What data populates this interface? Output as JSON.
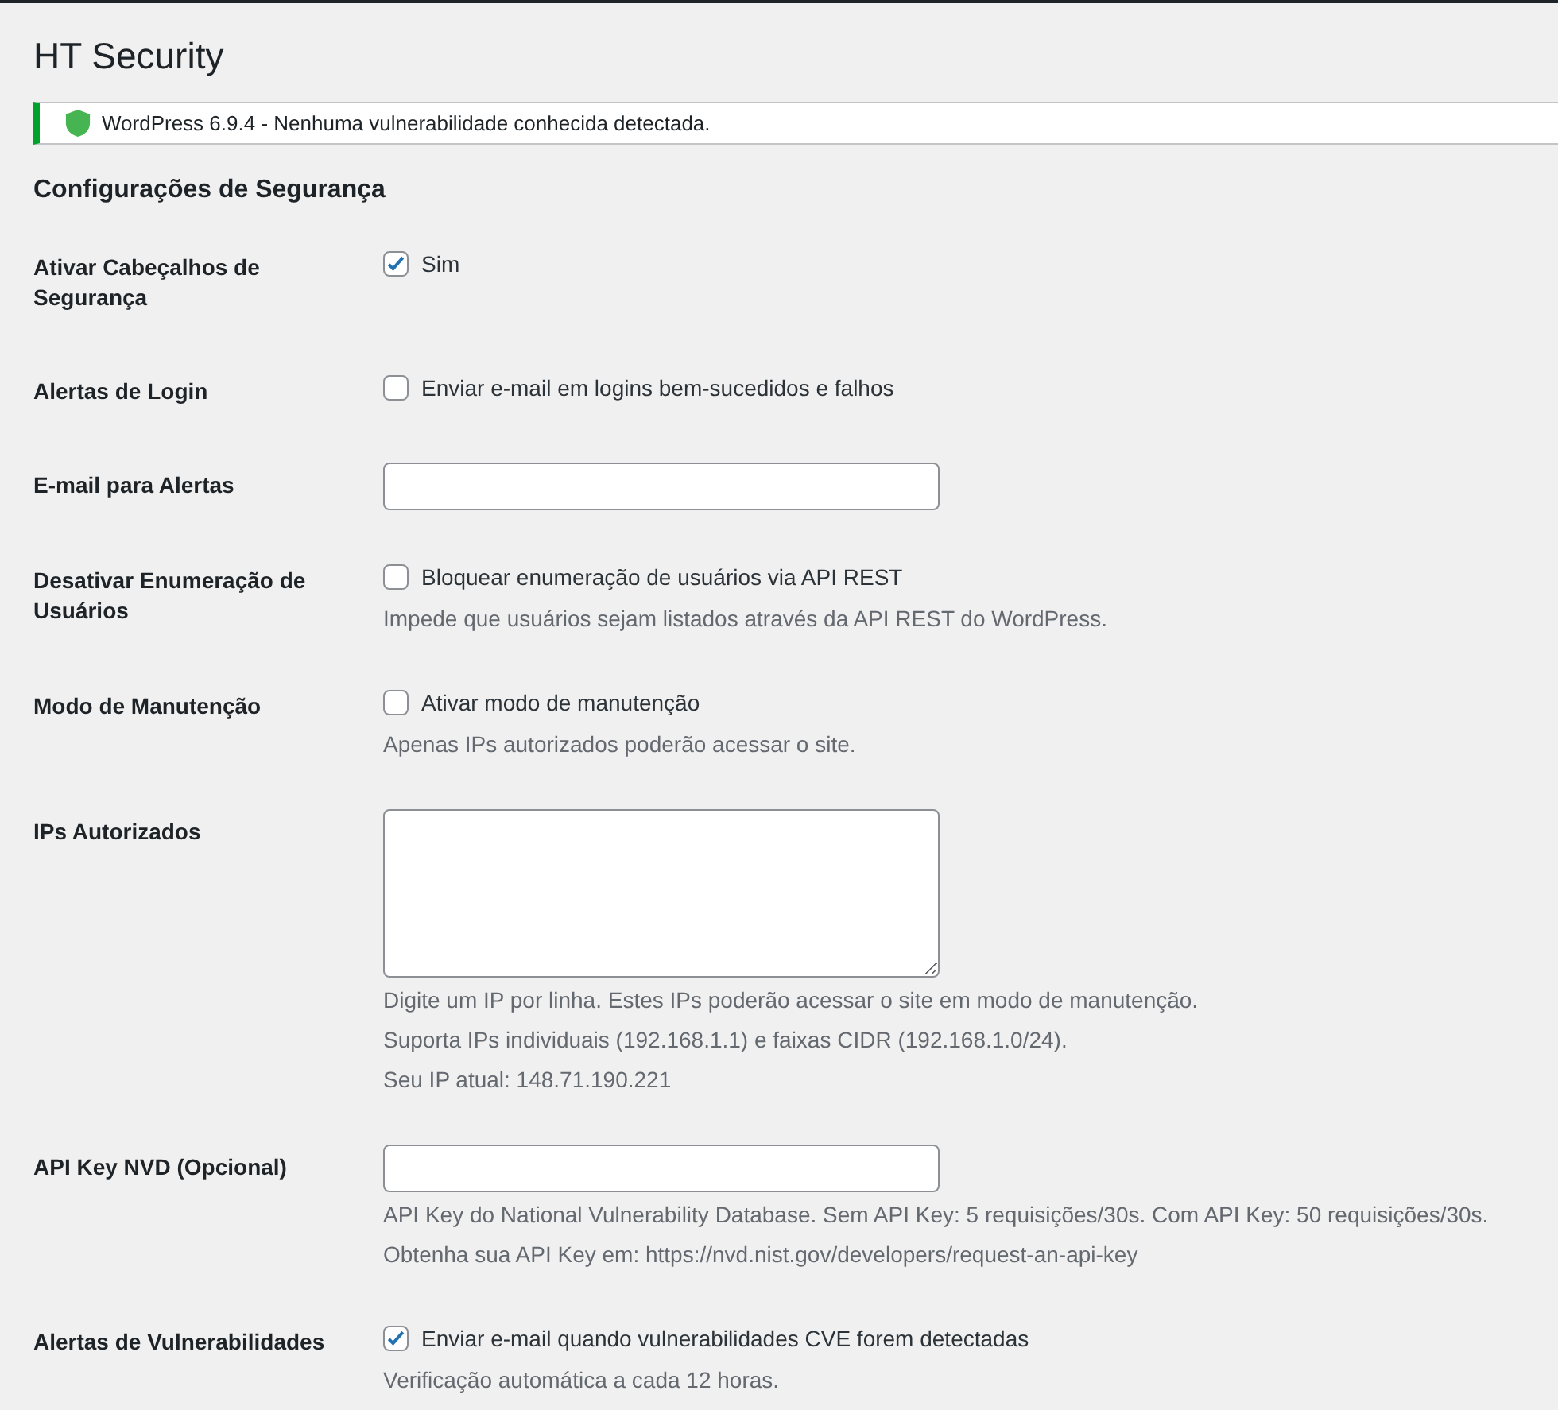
{
  "page_title": "HT Security",
  "notice": {
    "text": "WordPress 6.9.4 - Nenhuma vulnerabilidade conhecida detectada."
  },
  "section_title": "Configurações de Segurança",
  "fields": [
    {
      "label": "Ativar Cabeçalhos de Segurança",
      "kind": "checkbox",
      "checked": true,
      "option": "Sim"
    },
    {
      "label": "Alertas de Login",
      "kind": "checkbox",
      "checked": false,
      "option": "Enviar e-mail em logins bem-sucedidos e falhos"
    },
    {
      "label": "E-mail para Alertas",
      "kind": "text"
    },
    {
      "label": "Desativar Enumeração de Usuários",
      "kind": "checkbox",
      "checked": false,
      "option": "Bloquear enumeração de usuários via API REST",
      "descriptions": [
        "Impede que usuários sejam listados através da API REST do WordPress."
      ]
    },
    {
      "label": "Modo de Manutenção",
      "kind": "checkbox",
      "checked": false,
      "option": "Ativar modo de manutenção",
      "descriptions": [
        "Apenas IPs autorizados poderão acessar o site."
      ]
    },
    {
      "label": "IPs Autorizados",
      "kind": "textarea",
      "descriptions": [
        "Digite um IP por linha. Estes IPs poderão acessar o site em modo de manutenção.",
        "Suporta IPs individuais (192.168.1.1) e faixas CIDR (192.168.1.0/24).",
        "Seu IP atual: 148.71.190.221"
      ]
    },
    {
      "label": "API Key NVD (Opcional)",
      "kind": "text",
      "descriptions": [
        "API Key do National Vulnerability Database. Sem API Key: 5 requisições/30s. Com API Key: 50 requisições/30s.",
        "Obtenha sua API Key em: https://nvd.nist.gov/developers/request-an-api-key"
      ]
    },
    {
      "label": "Alertas de Vulnerabilidades",
      "kind": "checkbox",
      "checked": true,
      "option": "Enviar e-mail quando vulnerabilidades CVE forem detectadas",
      "descriptions": [
        "Verificação automática a cada 12 horas."
      ]
    }
  ]
}
